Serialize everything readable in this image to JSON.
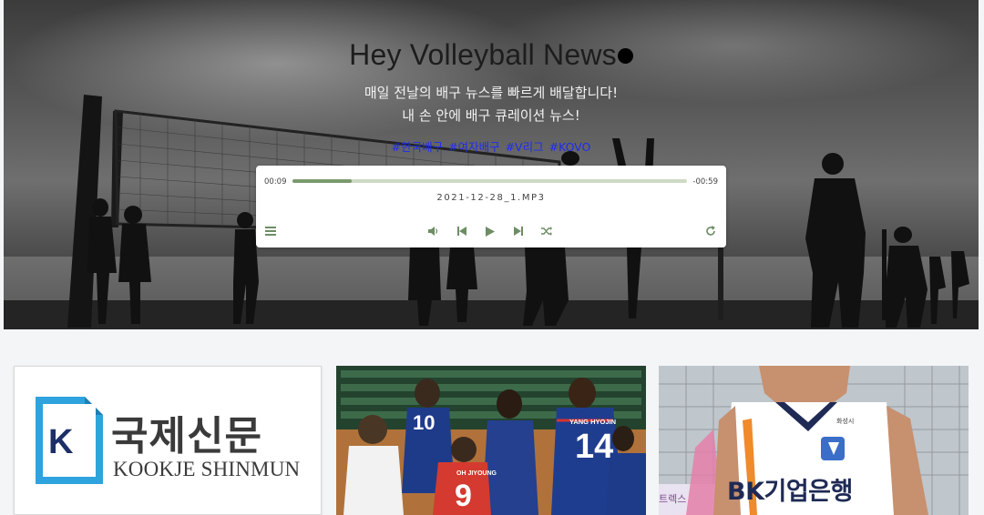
{
  "hero": {
    "title": "Hey Volleyball News",
    "subtitle_line1": "매일 전날의 배구 뉴스를 빠르게 배달합니다!",
    "subtitle_line2": "내 손 안에 배구 큐레이션 뉴스!",
    "tags": [
      "#한국배구",
      "#여자배구",
      "#V리그",
      "#KOVO"
    ]
  },
  "player": {
    "current_time": "00:09",
    "remaining_time": "-00:59",
    "progress": 0.15,
    "filename": "2021-12-28_1.MP3",
    "controls": [
      "playlist-icon",
      "volume-icon",
      "previous-icon",
      "play-icon",
      "next-icon",
      "shuffle-icon",
      "repeat-icon"
    ]
  },
  "cards": [
    {
      "logo_text_ko": "국제신문",
      "logo_text_en": "KOOKJE SHINMUN",
      "logo_letter": "K"
    },
    {
      "jersey_name_1": "YANG HYOJIN",
      "jersey_number_1": "14",
      "jersey_name_2": "OH JIYOUNG",
      "jersey_number_2": "9",
      "jersey_number_3": "10"
    },
    {
      "sponsor_text": "BK기업은행",
      "small_text": "화성시",
      "side_text": "트렉스"
    }
  ],
  "colors": {
    "tag_link": "#1e2cf0",
    "progress_fill": "#7a9a6e",
    "progress_track": "#cdd9c4",
    "control_icon": "#6d8d64",
    "logo_blue": "#2fa3dd"
  }
}
